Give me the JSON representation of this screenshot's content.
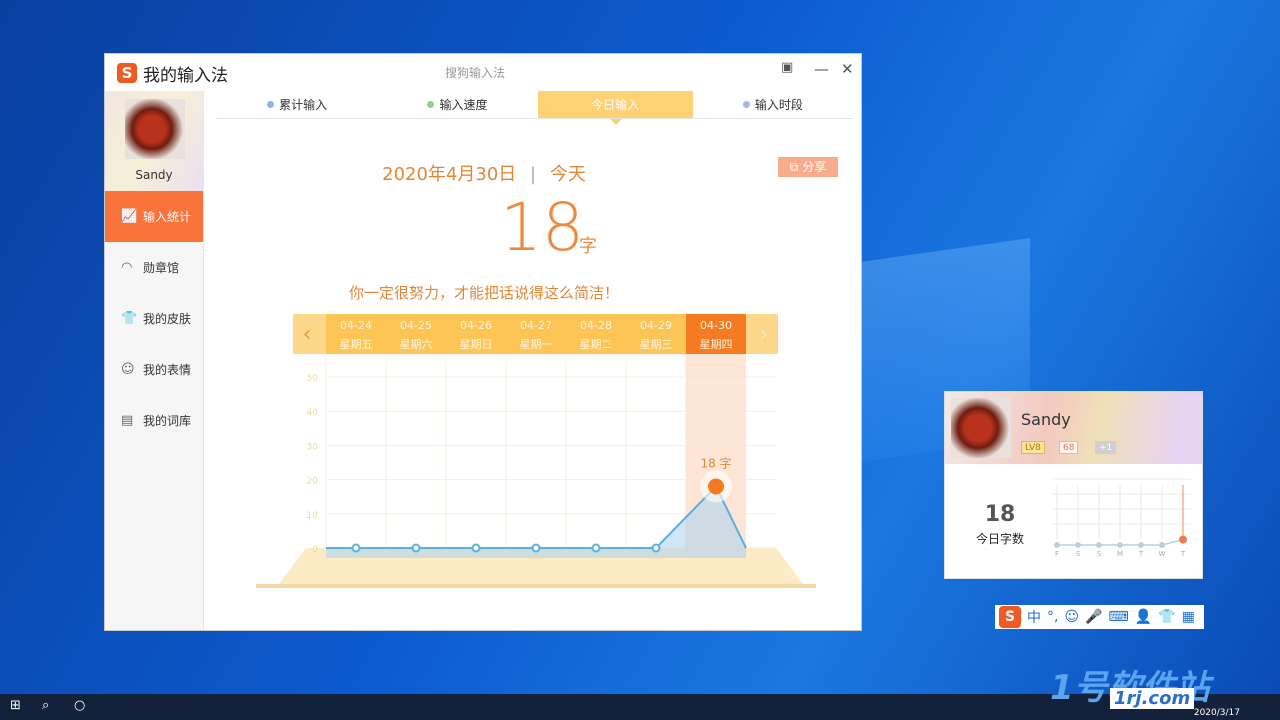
{
  "window": {
    "title": "我的输入法",
    "subtitle": "搜狗输入法",
    "logo": "S",
    "feedback_icon": "feedback-icon",
    "minimize": "—",
    "close": "✕"
  },
  "user": {
    "name": "Sandy"
  },
  "sidebar": {
    "items": [
      {
        "label": "输入统计",
        "icon": "chart-icon",
        "active": true
      },
      {
        "label": "勋章馆",
        "icon": "medal-icon"
      },
      {
        "label": "我的皮肤",
        "icon": "shirt-icon"
      },
      {
        "label": "我的表情",
        "icon": "smile-icon"
      },
      {
        "label": "我的词库",
        "icon": "book-icon"
      }
    ]
  },
  "tabs": [
    {
      "label": "累计输入",
      "dot": "#8ab8e6"
    },
    {
      "label": "输入速度",
      "dot": "#8fd18a"
    },
    {
      "label": "今日输入",
      "active": true
    },
    {
      "label": "输入时段",
      "dot": "#aab4e8"
    }
  ],
  "today": {
    "date": "2020年4月30日",
    "sep": "|",
    "today_label": "今天",
    "count": "18",
    "unit": "字",
    "motto": "你一定很努力，才能把话说得这么简洁！",
    "share": "分享"
  },
  "chart_data": {
    "type": "line",
    "categories": [
      "04-24",
      "04-25",
      "04-26",
      "04-27",
      "04-28",
      "04-29",
      "04-30"
    ],
    "weekdays": [
      "星期五",
      "星期六",
      "星期日",
      "星期一",
      "星期二",
      "星期三",
      "星期四"
    ],
    "values": [
      0,
      0,
      0,
      0,
      0,
      0,
      18
    ],
    "selected": "04-30",
    "yticks": [
      "0",
      "10",
      "20",
      "30",
      "40",
      "50"
    ],
    "ylim": [
      0,
      50
    ],
    "point_label": "18 字",
    "grid": true,
    "colors": {
      "line": "#5aaee6",
      "highlight": "#f57b22",
      "header": "#fdc456"
    }
  },
  "tray_card": {
    "name": "Sandy",
    "level": "LV8",
    "badge2": "68",
    "badge3": "+1",
    "count": "18",
    "count_label": "今日字数",
    "mini_chart": {
      "labels": [
        "F",
        "S",
        "S",
        "M",
        "T",
        "W",
        "T"
      ],
      "values": [
        0,
        0,
        0,
        0,
        0,
        0,
        18
      ]
    }
  },
  "ime_bar": {
    "logo": "S",
    "items": [
      "中",
      "°,",
      "☺",
      "🎤",
      "⌨",
      "👤",
      "👕",
      "▦"
    ]
  },
  "watermark": {
    "text": "1号软件站",
    "url": "1rj.com"
  },
  "taskbar": {
    "clock": "2020/3/17"
  }
}
